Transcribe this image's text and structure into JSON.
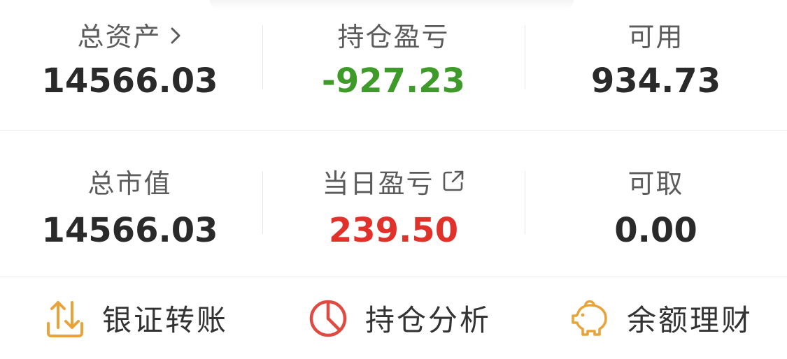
{
  "summary": {
    "total_assets": {
      "label": "总资产",
      "value": "14566.03",
      "icon": "chevron-right-icon"
    },
    "position_pnl": {
      "label": "持仓盈亏",
      "value": "-927.23",
      "color": "#3e9b29"
    },
    "available": {
      "label": "可用",
      "value": "934.73"
    },
    "market_value": {
      "label": "总市值",
      "value": "14566.03"
    },
    "daily_pnl": {
      "label": "当日盈亏",
      "value": "239.50",
      "color": "#e0322b",
      "icon": "external-link-icon"
    },
    "withdrawable": {
      "label": "可取",
      "value": "0.00"
    }
  },
  "actions": [
    {
      "label": "银证转账",
      "icon": "transfer-arrows-icon",
      "color": "#e8a43a"
    },
    {
      "label": "持仓分析",
      "icon": "pie-chart-icon",
      "color": "#e04a40"
    },
    {
      "label": "余额理财",
      "icon": "piggy-bank-icon",
      "color": "#e8a43a"
    }
  ],
  "colors": {
    "text_primary": "#2a2a2a",
    "text_label": "#5b5b5b",
    "loss_green": "#3e9b29",
    "gain_red": "#e0322b",
    "divider": "#ececec"
  }
}
